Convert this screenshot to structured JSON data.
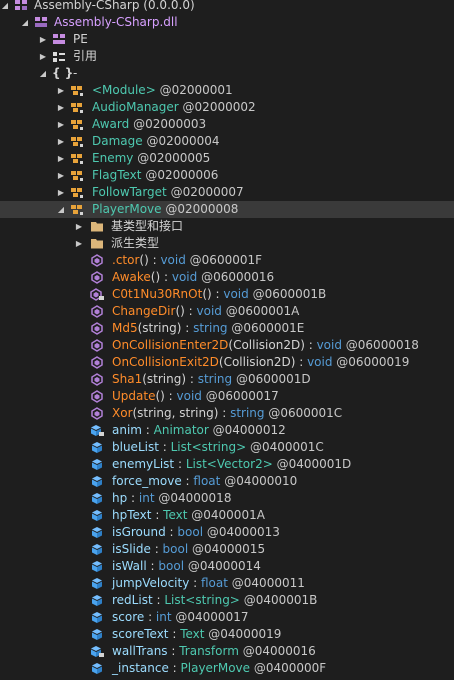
{
  "tree": {
    "assembly": {
      "name": "Assembly-CSharp",
      "version": "(0.0.0.0)"
    },
    "module": {
      "name": "Assembly-CSharp.dll"
    },
    "pe": {
      "label": "PE"
    },
    "refs": {
      "label": "引用"
    },
    "namespace": {
      "braces": "{ }",
      "label": "-"
    },
    "types": [
      {
        "name": "<Module>",
        "token": "@02000001"
      },
      {
        "name": "AudioManager",
        "token": "@02000002"
      },
      {
        "name": "Award",
        "token": "@02000003"
      },
      {
        "name": "Damage",
        "token": "@02000004"
      },
      {
        "name": "Enemy",
        "token": "@02000005"
      },
      {
        "name": "FlagText",
        "token": "@02000006"
      },
      {
        "name": "FollowTarget",
        "token": "@02000007"
      },
      {
        "name": "PlayerMove",
        "token": "@02000008"
      }
    ],
    "folders": [
      {
        "label": "基类型和接口"
      },
      {
        "label": "派生类型"
      }
    ],
    "methods": [
      {
        "name": ".ctor",
        "params": "()",
        "sep": " : ",
        "ret": "void",
        "token": " @0600001F"
      },
      {
        "name": "Awake",
        "params": "()",
        "sep": " : ",
        "ret": "void",
        "token": " @06000016"
      },
      {
        "name": "C0t1Nu30RnOt",
        "params": "()",
        "sep": " : ",
        "ret": "void",
        "token": " @0600001B"
      },
      {
        "name": "ChangeDir",
        "params": "()",
        "sep": " : ",
        "ret": "void",
        "token": " @0600001A"
      },
      {
        "name": "Md5",
        "params": "(string)",
        "sep": " : ",
        "ret": "string",
        "token": " @0600001E"
      },
      {
        "name": "OnCollisionEnter2D",
        "params": "(Collision2D)",
        "sep": " : ",
        "ret": "void",
        "token": " @06000018"
      },
      {
        "name": "OnCollisionExit2D",
        "params": "(Collision2D)",
        "sep": " : ",
        "ret": "void",
        "token": " @06000019"
      },
      {
        "name": "Sha1",
        "params": "(string)",
        "sep": " : ",
        "ret": "string",
        "token": " @0600001D"
      },
      {
        "name": "Update",
        "params": "()",
        "sep": " : ",
        "ret": "void",
        "token": " @06000017"
      },
      {
        "name": "Xor",
        "params": "(string, string)",
        "sep": " : ",
        "ret": "string",
        "token": " @0600001C"
      }
    ],
    "fields": [
      {
        "name": "anim",
        "sep": " : ",
        "type": "Animator",
        "token": " @04000012"
      },
      {
        "name": "blueList",
        "sep": " : ",
        "type": "List<string>",
        "token": " @0400001C"
      },
      {
        "name": "enemyList",
        "sep": " : ",
        "type": "List<Vector2>",
        "token": " @0400001D"
      },
      {
        "name": "force_move",
        "sep": " : ",
        "type": "float",
        "token": " @04000010"
      },
      {
        "name": "hp",
        "sep": " : ",
        "type": "int",
        "token": " @04000018"
      },
      {
        "name": "hpText",
        "sep": " : ",
        "type": "Text",
        "token": " @0400001A"
      },
      {
        "name": "isGround",
        "sep": " : ",
        "type": "bool",
        "token": " @04000013"
      },
      {
        "name": "isSlide",
        "sep": " : ",
        "type": "bool",
        "token": " @04000015"
      },
      {
        "name": "isWall",
        "sep": " : ",
        "type": "bool",
        "token": " @04000014"
      },
      {
        "name": "jumpVelocity",
        "sep": " : ",
        "type": "float",
        "token": " @04000011"
      },
      {
        "name": "redList",
        "sep": " : ",
        "type": "List<string>",
        "token": " @0400001B"
      },
      {
        "name": "score",
        "sep": " : ",
        "type": "int",
        "token": " @04000017"
      },
      {
        "name": "scoreText",
        "sep": " : ",
        "type": "Text",
        "token": " @04000019"
      },
      {
        "name": "wallTrans",
        "sep": " : ",
        "type": "Transform",
        "token": " @04000016"
      },
      {
        "name": "_instance",
        "sep": " : ",
        "type": "PlayerMove",
        "token": " @0400000F"
      }
    ]
  },
  "colors": {
    "background": "#1e1e1e",
    "selection": "#3a3a3a",
    "type": "#4ec9b0",
    "method": "#ff8c2a",
    "field": "#9cdcfe",
    "keyword": "#569cd6",
    "assembly": "#d7a0ff"
  }
}
